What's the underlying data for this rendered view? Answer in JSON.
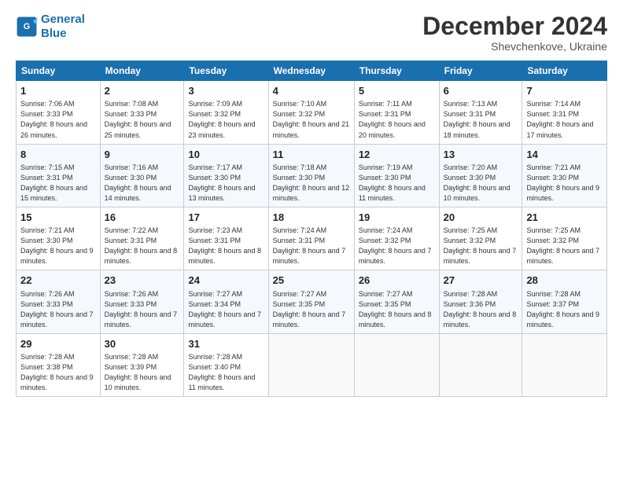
{
  "logo": {
    "line1": "General",
    "line2": "Blue"
  },
  "header": {
    "month": "December 2024",
    "location": "Shevchenkove, Ukraine"
  },
  "days_of_week": [
    "Sunday",
    "Monday",
    "Tuesday",
    "Wednesday",
    "Thursday",
    "Friday",
    "Saturday"
  ],
  "weeks": [
    [
      {
        "day": "1",
        "sunrise": "7:06 AM",
        "sunset": "3:33 PM",
        "daylight": "8 hours and 26 minutes."
      },
      {
        "day": "2",
        "sunrise": "7:08 AM",
        "sunset": "3:33 PM",
        "daylight": "8 hours and 25 minutes."
      },
      {
        "day": "3",
        "sunrise": "7:09 AM",
        "sunset": "3:32 PM",
        "daylight": "8 hours and 23 minutes."
      },
      {
        "day": "4",
        "sunrise": "7:10 AM",
        "sunset": "3:32 PM",
        "daylight": "8 hours and 21 minutes."
      },
      {
        "day": "5",
        "sunrise": "7:11 AM",
        "sunset": "3:31 PM",
        "daylight": "8 hours and 20 minutes."
      },
      {
        "day": "6",
        "sunrise": "7:13 AM",
        "sunset": "3:31 PM",
        "daylight": "8 hours and 18 minutes."
      },
      {
        "day": "7",
        "sunrise": "7:14 AM",
        "sunset": "3:31 PM",
        "daylight": "8 hours and 17 minutes."
      }
    ],
    [
      {
        "day": "8",
        "sunrise": "7:15 AM",
        "sunset": "3:31 PM",
        "daylight": "8 hours and 15 minutes."
      },
      {
        "day": "9",
        "sunrise": "7:16 AM",
        "sunset": "3:30 PM",
        "daylight": "8 hours and 14 minutes."
      },
      {
        "day": "10",
        "sunrise": "7:17 AM",
        "sunset": "3:30 PM",
        "daylight": "8 hours and 13 minutes."
      },
      {
        "day": "11",
        "sunrise": "7:18 AM",
        "sunset": "3:30 PM",
        "daylight": "8 hours and 12 minutes."
      },
      {
        "day": "12",
        "sunrise": "7:19 AM",
        "sunset": "3:30 PM",
        "daylight": "8 hours and 11 minutes."
      },
      {
        "day": "13",
        "sunrise": "7:20 AM",
        "sunset": "3:30 PM",
        "daylight": "8 hours and 10 minutes."
      },
      {
        "day": "14",
        "sunrise": "7:21 AM",
        "sunset": "3:30 PM",
        "daylight": "8 hours and 9 minutes."
      }
    ],
    [
      {
        "day": "15",
        "sunrise": "7:21 AM",
        "sunset": "3:30 PM",
        "daylight": "8 hours and 9 minutes."
      },
      {
        "day": "16",
        "sunrise": "7:22 AM",
        "sunset": "3:31 PM",
        "daylight": "8 hours and 8 minutes."
      },
      {
        "day": "17",
        "sunrise": "7:23 AM",
        "sunset": "3:31 PM",
        "daylight": "8 hours and 8 minutes."
      },
      {
        "day": "18",
        "sunrise": "7:24 AM",
        "sunset": "3:31 PM",
        "daylight": "8 hours and 7 minutes."
      },
      {
        "day": "19",
        "sunrise": "7:24 AM",
        "sunset": "3:32 PM",
        "daylight": "8 hours and 7 minutes."
      },
      {
        "day": "20",
        "sunrise": "7:25 AM",
        "sunset": "3:32 PM",
        "daylight": "8 hours and 7 minutes."
      },
      {
        "day": "21",
        "sunrise": "7:25 AM",
        "sunset": "3:32 PM",
        "daylight": "8 hours and 7 minutes."
      }
    ],
    [
      {
        "day": "22",
        "sunrise": "7:26 AM",
        "sunset": "3:33 PM",
        "daylight": "8 hours and 7 minutes."
      },
      {
        "day": "23",
        "sunrise": "7:26 AM",
        "sunset": "3:33 PM",
        "daylight": "8 hours and 7 minutes."
      },
      {
        "day": "24",
        "sunrise": "7:27 AM",
        "sunset": "3:34 PM",
        "daylight": "8 hours and 7 minutes."
      },
      {
        "day": "25",
        "sunrise": "7:27 AM",
        "sunset": "3:35 PM",
        "daylight": "8 hours and 7 minutes."
      },
      {
        "day": "26",
        "sunrise": "7:27 AM",
        "sunset": "3:35 PM",
        "daylight": "8 hours and 8 minutes."
      },
      {
        "day": "27",
        "sunrise": "7:28 AM",
        "sunset": "3:36 PM",
        "daylight": "8 hours and 8 minutes."
      },
      {
        "day": "28",
        "sunrise": "7:28 AM",
        "sunset": "3:37 PM",
        "daylight": "8 hours and 9 minutes."
      }
    ],
    [
      {
        "day": "29",
        "sunrise": "7:28 AM",
        "sunset": "3:38 PM",
        "daylight": "8 hours and 9 minutes."
      },
      {
        "day": "30",
        "sunrise": "7:28 AM",
        "sunset": "3:39 PM",
        "daylight": "8 hours and 10 minutes."
      },
      {
        "day": "31",
        "sunrise": "7:28 AM",
        "sunset": "3:40 PM",
        "daylight": "8 hours and 11 minutes."
      },
      null,
      null,
      null,
      null
    ]
  ]
}
